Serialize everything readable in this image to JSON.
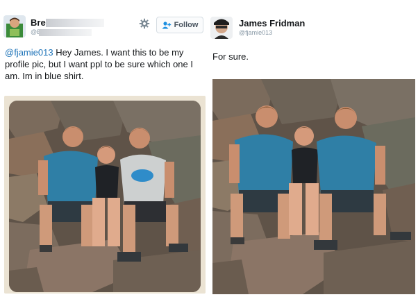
{
  "left_tweet": {
    "user_name": "Bre",
    "user_handle": "@B",
    "follow_label": "Follow",
    "mention": "@fjamie013",
    "text": " Hey James. I want this to be my profile pic, but I want ppl to be sure which one I am. Im in blue shirt.",
    "photo": {
      "description": "original photo",
      "people": 3
    }
  },
  "right_tweet": {
    "user_name": "James Fridman",
    "user_handle": "@fjamie013",
    "text": "For sure.",
    "photo": {
      "description": "edited photo",
      "people": 3
    }
  },
  "colors": {
    "link": "#1d73b8",
    "blue_shirt": "#2f7fa6",
    "handle_gray": "#8899a6"
  },
  "icons": [
    "gear-icon",
    "follow-person-icon",
    "avatar"
  ]
}
